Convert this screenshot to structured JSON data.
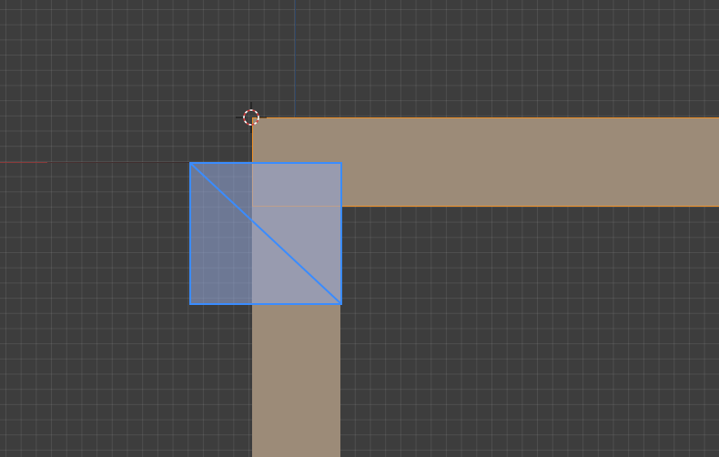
{
  "viewport": {
    "background_color": "#3d3d3d",
    "grid_color": "rgba(255,255,255,0.085)"
  },
  "axes": {
    "x_color": "#8a3a3a",
    "y_color": "#2e4666"
  },
  "objects": [
    {
      "name": "horizontal-beam",
      "fill": "#9c8b78",
      "outline": "#f0922a",
      "selected": true
    },
    {
      "name": "vertical-beam",
      "fill": "#9c8b78",
      "selected": false
    }
  ],
  "selected_face": {
    "edge_color": "#3a8cff",
    "fill": "rgba(150,170,220,0.55)",
    "diagonal": true
  },
  "cursor_3d": {
    "ring_colors": [
      "#ffffff",
      "#d33b3b"
    ]
  }
}
